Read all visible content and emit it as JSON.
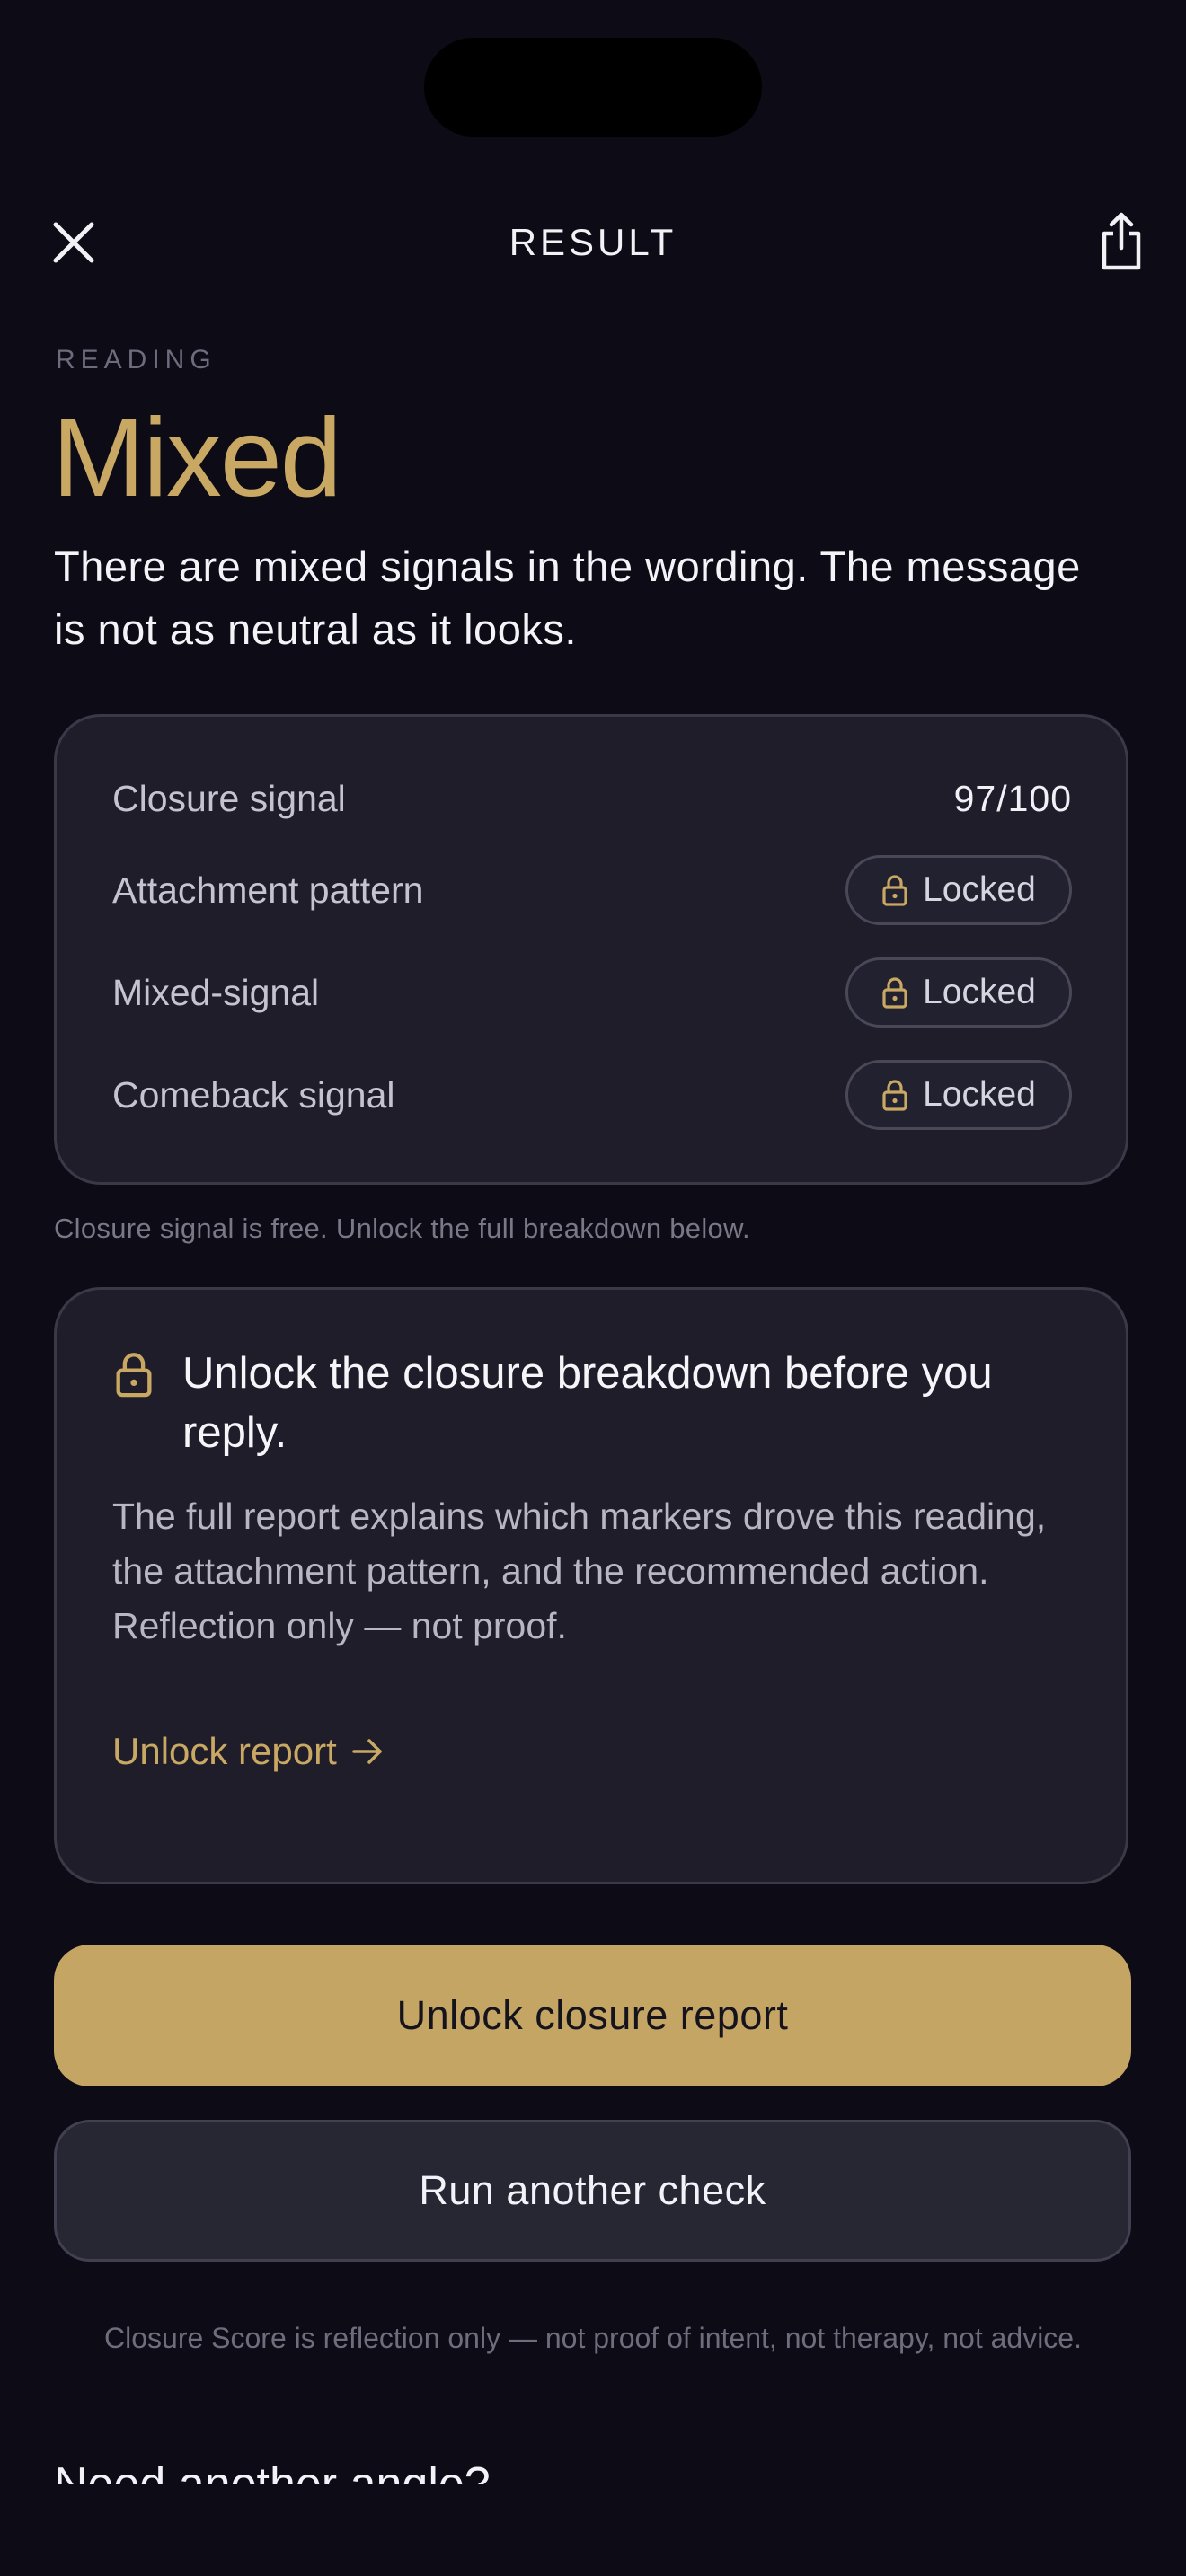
{
  "header": {
    "title": "RESULT",
    "close_icon": "close-icon",
    "share_icon": "share-icon"
  },
  "reading": {
    "eyebrow": "READING",
    "verdict": "Mixed",
    "summary": "There are mixed signals in the wording. The message is not as neutral as it looks."
  },
  "signals": [
    {
      "label": "Closure signal",
      "value": "97/100",
      "locked": false
    },
    {
      "label": "Attachment pattern",
      "value": "Locked",
      "locked": true
    },
    {
      "label": "Mixed-signal",
      "value": "Locked",
      "locked": true
    },
    {
      "label": "Comeback signal",
      "value": "Locked",
      "locked": true
    }
  ],
  "free_note": "Closure signal is free. Unlock the full breakdown below.",
  "unlock_card": {
    "heading": "Unlock the closure breakdown before you reply.",
    "body": "The full report explains which markers drove this reading, the attachment pattern, and the recommended action. Reflection only — not proof.",
    "link_label": "Unlock report",
    "link_icon": "arrow-right-icon"
  },
  "actions": {
    "primary_label": "Unlock closure report",
    "secondary_label": "Run another check"
  },
  "disclaimer": "Closure Score is reflection only — not proof of intent, not therapy, not advice.",
  "next_section": {
    "heading": "Need another angle?"
  },
  "colors": {
    "background": "#0c0b16",
    "card": "#1e1d29",
    "accent_gold": "#c9a864",
    "button_gold": "#c5a564"
  }
}
